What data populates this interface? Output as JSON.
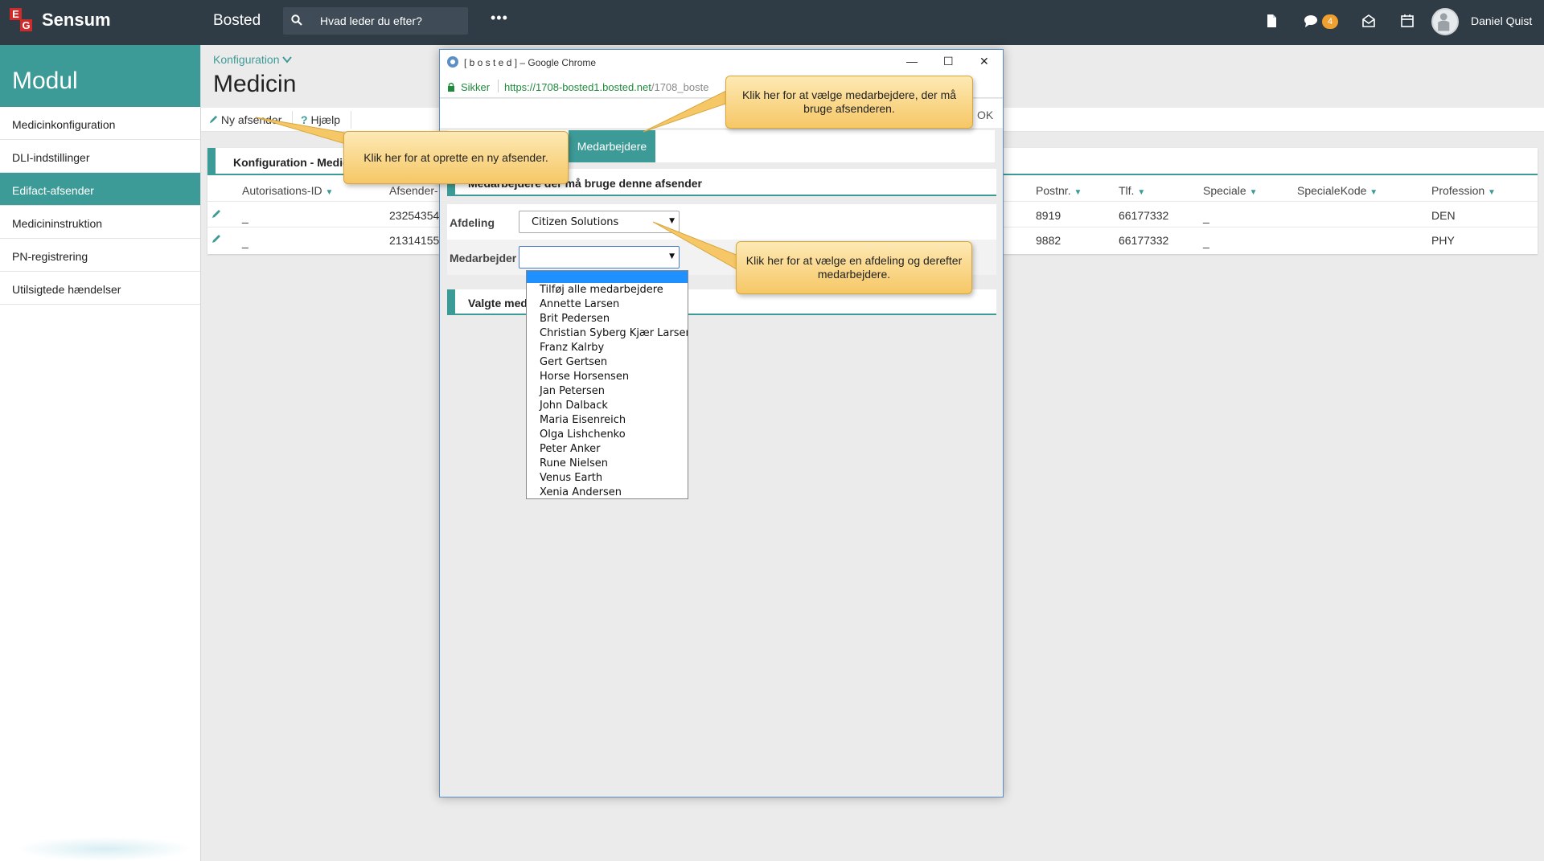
{
  "topbar": {
    "brand": "Sensum",
    "logo_letters": [
      "E",
      "G"
    ],
    "section": "Bosted",
    "search_placeholder": "Hvad leder du efter?",
    "more": "•••",
    "badge_count": "4",
    "username": "Daniel Quist",
    "icons": [
      "document-icon",
      "chat-icon",
      "envelope-icon",
      "calendar-icon"
    ]
  },
  "sidebar": {
    "heading": "Modul",
    "items": [
      {
        "label": "Medicinkonfiguration",
        "active": false
      },
      {
        "label": "DLI-indstillinger",
        "active": false
      },
      {
        "label": "Edifact-afsender",
        "active": true
      },
      {
        "label": "Medicininstruktion",
        "active": false
      },
      {
        "label": "PN-registrering",
        "active": false
      },
      {
        "label": "Utilsigtede hændelser",
        "active": false
      }
    ]
  },
  "main": {
    "breadcrumb": "Konfiguration",
    "title": "Medicin",
    "toolbar": {
      "new_sender": "Ny afsender",
      "help": "Hjælp"
    },
    "panel_title": "Konfiguration - Medici",
    "columns": [
      "Autorisations-ID",
      "Afsender-",
      "Postnr.",
      "Tlf.",
      "Speciale",
      "SpecialeKode",
      "Profession"
    ],
    "rows": [
      {
        "autorisation": "_",
        "afsender": "23254354",
        "postnr": "8919",
        "tlf": "66177332",
        "speciale": "_",
        "profession": "DEN"
      },
      {
        "autorisation": "_",
        "afsender": "21314155",
        "postnr": "9882",
        "tlf": "66177332",
        "speciale": "_",
        "profession": "PHY"
      }
    ]
  },
  "popup": {
    "window_title": "[ b o s t e d ] – Google Chrome",
    "secure_label": "Sikker",
    "url_main": "https://1708-bosted1.bosted.net",
    "url_rest": "/1708_boste",
    "ok_label": "OK",
    "tab_label": "Medarbejdere",
    "section1_title": "Medarbejdere der må bruge denne afsender",
    "afdeling_label": "Afdeling",
    "afdeling_value": "Citizen Solutions",
    "medarbejder_label": "Medarbejder",
    "medarbejder_value": "",
    "section2_title": "Valgte meda",
    "dropdown_options": [
      "Tilføj alle medarbejdere",
      "Annette Larsen",
      "Brit Pedersen",
      "Christian Syberg Kjær Larsen",
      "Franz Kalrby",
      "Gert Gertsen",
      "Horse Horsensen",
      "Jan Petersen",
      "John Dalback",
      "Maria Eisenreich",
      "Olga Lishchenko",
      "Peter Anker",
      "Rune Nielsen",
      "Venus Earth",
      "Xenia Andersen"
    ]
  },
  "callouts": {
    "new_sender": "Klik her for at oprette en ny afsender.",
    "choose_employees": "Klik her for at vælge medarbejdere, der må bruge afsenderen.",
    "choose_department": "Klik her for at vælge en afdeling og derefter medarbejdere."
  },
  "colors": {
    "accent": "#3d9b97",
    "topbar": "#2f3b45",
    "callout": "#f6c766",
    "badge": "#f0a030"
  }
}
